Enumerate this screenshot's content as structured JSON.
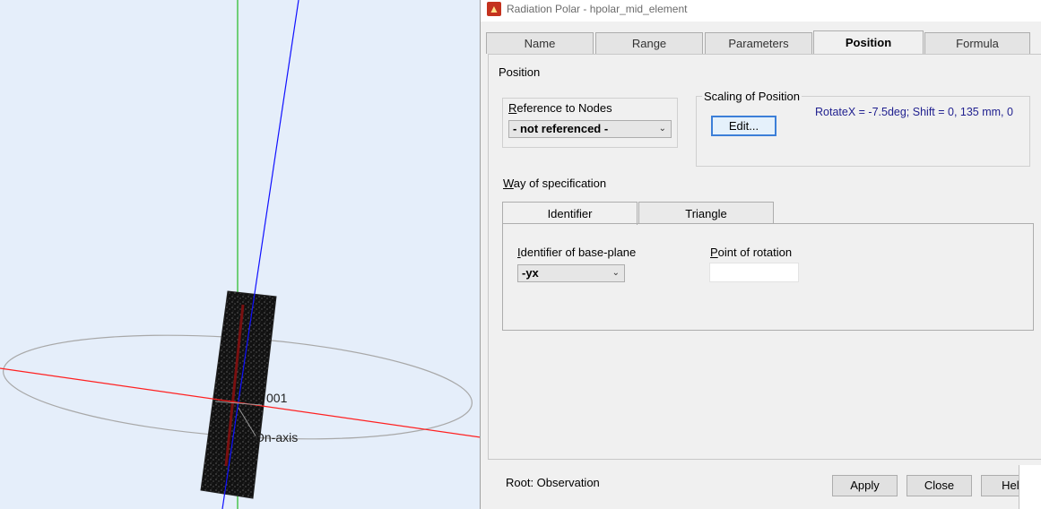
{
  "viewport": {
    "labels": {
      "element_id": "001",
      "on_axis": "On-axis"
    }
  },
  "window": {
    "title": "Radiation Polar - hpolar_mid_element",
    "tabs": [
      {
        "label": "Name",
        "active": false
      },
      {
        "label": "Range",
        "active": false
      },
      {
        "label": "Parameters",
        "active": false
      },
      {
        "label": "Position",
        "active": true
      },
      {
        "label": "Formula",
        "active": false
      }
    ]
  },
  "position_panel": {
    "section_title": "Position",
    "reference": {
      "label_u": "R",
      "label_rest": "eference to Nodes",
      "selected": "- not referenced -"
    },
    "scaling": {
      "title": "Scaling of Position",
      "edit_label": "Edit...",
      "value": "RotateX = -7.5deg;  Shift = 0, 135 mm, 0"
    },
    "way": {
      "label_u": "W",
      "label_rest": "ay of specification",
      "subtabs": [
        {
          "label": "Identifier",
          "active": true
        },
        {
          "label": "Triangle",
          "active": false
        }
      ],
      "base_plane_label_u": "I",
      "base_plane_label_rest": "dentifier of base-plane",
      "base_plane_selected": "-yx",
      "rotation_label_u": "P",
      "rotation_label_rest": "oint of rotation",
      "rotation_value": ""
    }
  },
  "footer": {
    "root_text": "Root: Observation",
    "apply_label": "Apply",
    "close_label": "Close",
    "help_label": "Help"
  },
  "colors": {
    "axis_x": "#ff2020",
    "axis_y": "#22bb22",
    "axis_z": "#1010ff",
    "accent": "#3c7fd8"
  }
}
